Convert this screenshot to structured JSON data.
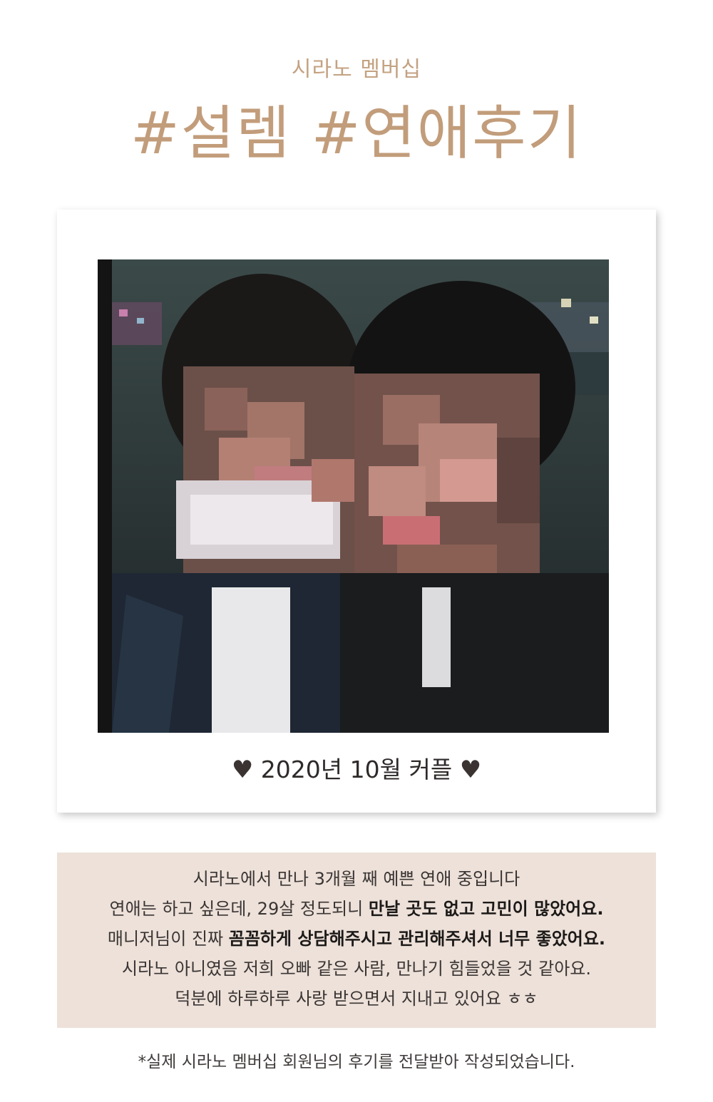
{
  "header": {
    "eyebrow": "시라노 멤버십",
    "headline": "#설렘 #연애후기"
  },
  "polaroid": {
    "heart_left": "♥",
    "caption": "2020년 10월 커플",
    "heart_right": "♥"
  },
  "review": {
    "line1": "시라노에서 만나 3개월 째 예쁜 연애 중입니다",
    "line2_plain": "연애는 하고 싶은데, 29살 정도되니 ",
    "line2_bold": "만날 곳도 없고 고민이 많았어요.",
    "line3_plain": "매니저님이 진짜 ",
    "line3_bold": "꼼꼼하게 상담해주시고 관리해주셔서 너무 좋았어요.",
    "line4": "시라노 아니였음 저희 오빠 같은 사람, 만나기 힘들었을 것 같아요.",
    "line5": "덕분에 하루하루 사랑 받으면서 지내고 있어요 ㅎㅎ"
  },
  "footnote": "*실제 시라노 멤버십 회원님의 후기를 전달받아 작성되었습니다.",
  "colors": {
    "accent": "#c29d7b",
    "review_bg": "#ede1d9",
    "text_dark": "#2e2a29"
  }
}
